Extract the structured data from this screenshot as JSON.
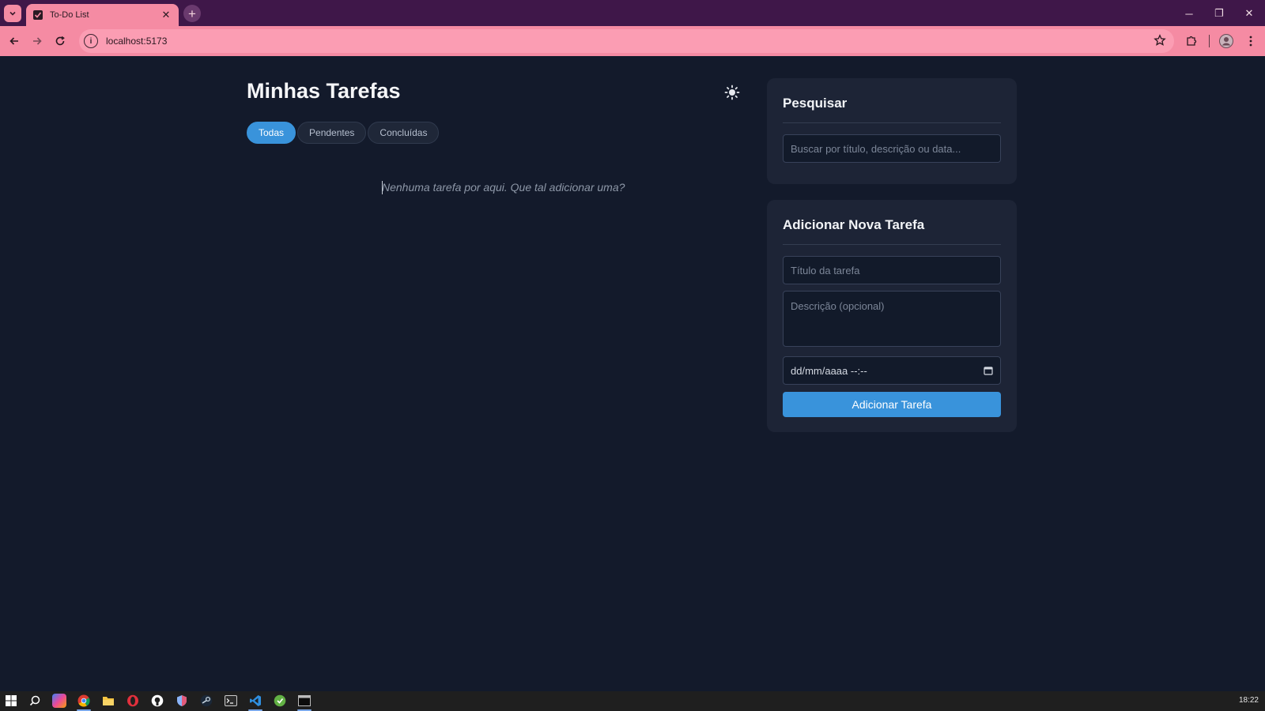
{
  "browser": {
    "tab_title": "To-Do List",
    "tab_close": "✕",
    "new_tab": "+",
    "url": "localhost:5173",
    "window_controls": {
      "minimize": "─",
      "restore": "❐",
      "close": "✕"
    }
  },
  "app": {
    "title": "Minhas Tarefas",
    "filters": [
      {
        "label": "Todas",
        "active": true
      },
      {
        "label": "Pendentes",
        "active": false
      },
      {
        "label": "Concluídas",
        "active": false
      }
    ],
    "empty_message": "Nenhuma tarefa por aqui. Que tal adicionar uma?"
  },
  "search": {
    "heading": "Pesquisar",
    "placeholder": "Buscar por título, descrição ou data..."
  },
  "new_task": {
    "heading": "Adicionar Nova Tarefa",
    "title_placeholder": "Título da tarefa",
    "description_placeholder": "Descrição (opcional)",
    "date_value": "dd/mm/aaaa --:--",
    "submit_label": "Adicionar Tarefa"
  },
  "taskbar": {
    "apps": [
      "windows-start",
      "search",
      "copilot",
      "chrome",
      "file-explorer",
      "opera",
      "github",
      "app",
      "steam",
      "terminal",
      "vscode",
      "app-green",
      "terminal-dark"
    ],
    "clock": "18:22"
  },
  "colors": {
    "accent": "#3993db",
    "background": "#131a2b",
    "card": "#1d2436",
    "browser_frame": "#3f1749",
    "browser_toolbar": "#f58ba3"
  }
}
